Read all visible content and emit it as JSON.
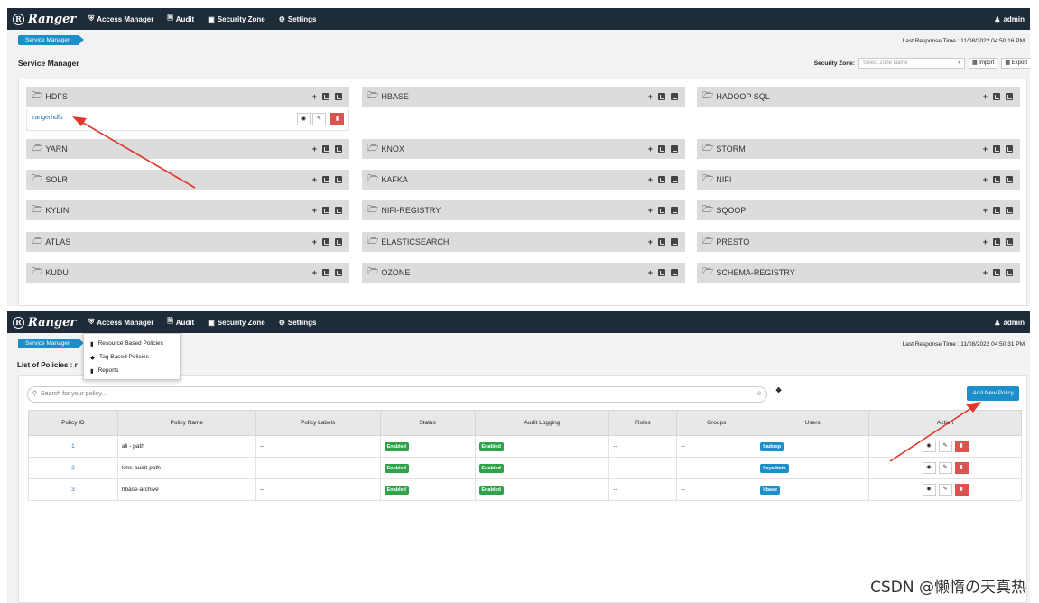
{
  "top": {
    "nav": {
      "brand": "Ranger",
      "items": [
        {
          "icon": "shield-icon",
          "label": "Access Manager"
        },
        {
          "icon": "file-icon",
          "label": "Audit"
        },
        {
          "icon": "zone-icon",
          "label": "Security Zone"
        },
        {
          "icon": "gear-icon",
          "label": "Settings"
        }
      ],
      "user": "admin"
    },
    "breadcrumb": "Service Manager",
    "last_response": "Last Response Time : 11/08/2022 04:50:16 PM",
    "page_title": "Service Manager",
    "security_zone_label": "Security Zone:",
    "zone_placeholder": "Select Zone Name",
    "import_label": "Import",
    "export_label": "Export",
    "services": [
      {
        "name": "HDFS",
        "expanded": true,
        "repo": "rangerhdfs"
      },
      {
        "name": "HBASE"
      },
      {
        "name": "HADOOP SQL"
      },
      {
        "name": "YARN"
      },
      {
        "name": "KNOX"
      },
      {
        "name": "STORM"
      },
      {
        "name": "SOLR"
      },
      {
        "name": "KAFKA"
      },
      {
        "name": "NIFI"
      },
      {
        "name": "KYLIN"
      },
      {
        "name": "NIFI-REGISTRY"
      },
      {
        "name": "SQOOP"
      },
      {
        "name": "ATLAS"
      },
      {
        "name": "ELASTICSEARCH"
      },
      {
        "name": "PRESTO"
      },
      {
        "name": "KUDU"
      },
      {
        "name": "OZONE"
      },
      {
        "name": "SCHEMA-REGISTRY"
      }
    ],
    "add_symbol": "+"
  },
  "bottom": {
    "nav": {
      "brand": "Ranger",
      "items": [
        {
          "icon": "shield-icon",
          "label": "Access Manager"
        },
        {
          "icon": "file-icon",
          "label": "Audit"
        },
        {
          "icon": "zone-icon",
          "label": "Security Zone"
        },
        {
          "icon": "gear-icon",
          "label": "Settings"
        }
      ],
      "user": "admin"
    },
    "breadcrumb": "Service Manager",
    "last_response": "Last Response Time : 11/08/2022 04:50:31 PM",
    "dropdown": [
      "Resource Based Policies",
      "Tag Based Policies",
      "Reports"
    ],
    "list_title": "List of Policies : r",
    "search_placeholder": "Search for your policy...",
    "info_symbol": "i",
    "add_policy": "Add New Policy",
    "columns": [
      "Policy ID",
      "Policy Name",
      "Policy Labels",
      "Status",
      "Audit Logging",
      "Roles",
      "Groups",
      "Users",
      "Action"
    ],
    "rows": [
      {
        "id": "1",
        "name": "all - path",
        "labels": "--",
        "status": "Enabled",
        "audit": "Enabled",
        "roles": "--",
        "groups": "--",
        "user": "hadoop"
      },
      {
        "id": "2",
        "name": "kms-audit-path",
        "labels": "--",
        "status": "Enabled",
        "audit": "Enabled",
        "roles": "--",
        "groups": "--",
        "user": "keyadmin"
      },
      {
        "id": "3",
        "name": "hbase-archive",
        "labels": "--",
        "status": "Enabled",
        "audit": "Enabled",
        "roles": "--",
        "groups": "--",
        "user": "hbase"
      }
    ]
  },
  "watermark": "CSDN @懒惰の天真热",
  "colors": {
    "navbar": "#1e2c3a",
    "accent": "#1c8ec9",
    "enabled": "#2fa34a",
    "delete": "#d9534f",
    "arrow": "#e2372a"
  }
}
